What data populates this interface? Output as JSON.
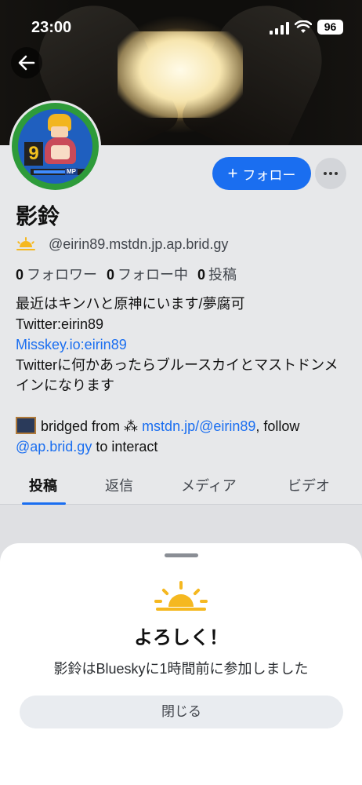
{
  "status_bar": {
    "time": "23:00",
    "battery": "96"
  },
  "profile": {
    "display_name": "影鈴",
    "handle": "@eirin89.mstdn.jp.ap.brid.gy",
    "avatar_level": "9",
    "avatar_badge": "MP",
    "stats": {
      "followers_count": "0",
      "followers_label": "フォロワー",
      "following_count": "0",
      "following_label": "フォロー中",
      "posts_count": "0",
      "posts_label": "投稿"
    },
    "bio": {
      "line1": "最近はキンハと原神にいます/夢腐可",
      "line2": "Twitter:eirin89",
      "link": "Misskey.io:eirin89",
      "line3": "Twitterに何かあったらブルースカイとマストドンメインになります"
    },
    "bridged": {
      "prefix": "bridged from ⁂ ",
      "source_link": "mstdn.jp/@eirin89",
      "middle": ", follow",
      "follow_link": "@ap.brid.gy",
      "suffix": " to interact"
    }
  },
  "actions": {
    "follow_label": "フォロー"
  },
  "tabs": [
    {
      "label": "投稿",
      "active": true
    },
    {
      "label": "返信",
      "active": false
    },
    {
      "label": "メディア",
      "active": false
    },
    {
      "label": "ビデオ",
      "active": false
    }
  ],
  "sheet": {
    "title": "よろしく！",
    "subtitle": "影鈴はBlueskyに1時間前に参加しました",
    "close_label": "閉じる"
  },
  "colors": {
    "accent": "#1a6ef0",
    "sun": "#f5b820"
  }
}
